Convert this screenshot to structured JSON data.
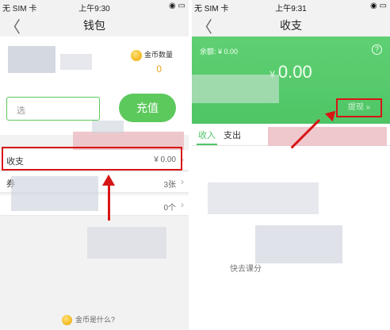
{
  "left_screen": {
    "status": {
      "carrier": "无 SIM 卡 ",
      "time": "上午9:30",
      "icons": "◉ ▭"
    },
    "nav": {
      "back": "〈",
      "title": "钱包"
    },
    "coins": {
      "label": "金币数量",
      "count": "0"
    },
    "input": {
      "text": "选"
    },
    "recharge_button": "充值",
    "rows": [
      {
        "label": "收支",
        "value": "¥ 0.00"
      },
      {
        "label": "券",
        "value": "3张"
      },
      {
        "label": "",
        "value": "0个"
      }
    ],
    "footer": {
      "text": "金币是什么?"
    }
  },
  "right_screen": {
    "status": {
      "carrier": "无 SIM 卡 ",
      "time": "上午9:31",
      "icons": "◉ ▭"
    },
    "nav": {
      "back": "〈",
      "title": "收支"
    },
    "balance": {
      "label": "余额: ¥ 0.00",
      "currency": "¥",
      "amount": "0.00",
      "help": "?"
    },
    "withdraw_button": "提现 »",
    "tabs": [
      {
        "label": "收入"
      },
      {
        "label": "支出"
      }
    ],
    "empty_text": "快去课分"
  },
  "colors": {
    "accent_green": "#5cc95c",
    "highlight_red": "#d71515",
    "coin_gold": "#f2b61c"
  }
}
